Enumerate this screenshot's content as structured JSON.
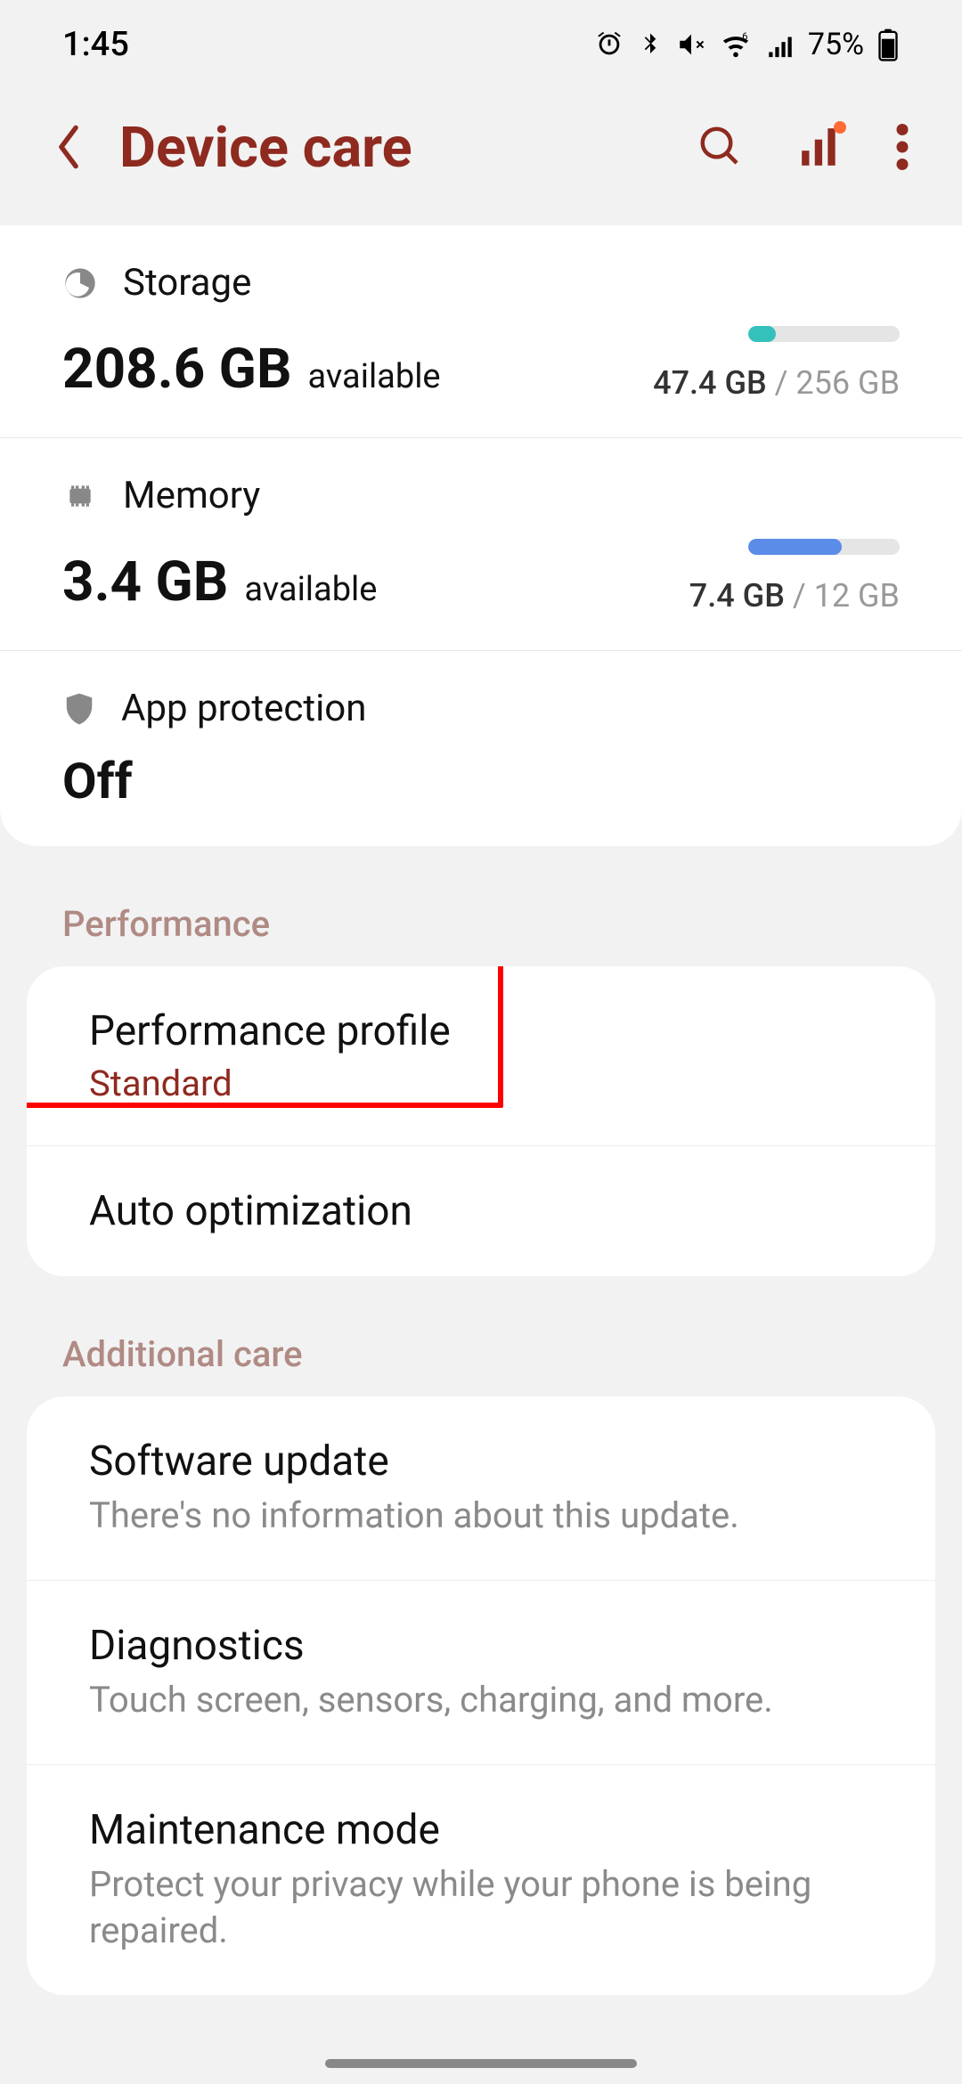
{
  "status_bar": {
    "time": "1:45",
    "battery_pct": "75%"
  },
  "header": {
    "title": "Device care"
  },
  "storage": {
    "label": "Storage",
    "value": "208.6 GB",
    "suffix": "available",
    "used": "47.4 GB",
    "total": "256 GB",
    "progress_pct": 18
  },
  "memory": {
    "label": "Memory",
    "value": "3.4 GB",
    "suffix": "available",
    "used": "7.4 GB",
    "total": "12 GB",
    "progress_pct": 62
  },
  "app_protection": {
    "label": "App protection",
    "status": "Off"
  },
  "sections": {
    "performance": {
      "header": "Performance",
      "items": [
        {
          "title": "Performance profile",
          "subtitle": "Standard"
        },
        {
          "title": "Auto optimization"
        }
      ]
    },
    "additional_care": {
      "header": "Additional care",
      "items": [
        {
          "title": "Software update",
          "desc": "There's no information about this update."
        },
        {
          "title": "Diagnostics",
          "desc": "Touch screen, sensors, charging, and more."
        },
        {
          "title": "Maintenance mode",
          "desc": "Protect your privacy while your phone is being repaired."
        }
      ]
    }
  }
}
